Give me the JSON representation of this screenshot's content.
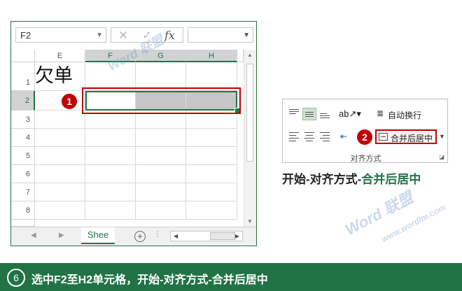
{
  "formula_bar": {
    "name_box": "F2",
    "fx": "fx"
  },
  "columns": [
    {
      "label": "E",
      "selected": false
    },
    {
      "label": "F",
      "selected": true
    },
    {
      "label": "G",
      "selected": true
    },
    {
      "label": "H",
      "selected": true
    }
  ],
  "rows": [
    "1",
    "2",
    "3",
    "4",
    "5",
    "6",
    "7",
    "8"
  ],
  "selected_row": "2",
  "cell_text": "欠单",
  "sheet_tab": "Shee",
  "badges": {
    "one": "1",
    "two": "2"
  },
  "ribbon": {
    "wrap_text": "自动换行",
    "merge_center": "合并后居中",
    "group_label": "对齐方式"
  },
  "caption": {
    "prefix": "开始-对齐方式-",
    "highlight": "合并后居中"
  },
  "bottom": {
    "step": "6",
    "text": "选中F2至H2单元格，开始-对齐方式-合并后居中"
  },
  "watermark": {
    "big": "Word 联盟",
    "small": "www.wordlm.com"
  },
  "colors": {
    "excel_green": "#217346",
    "highlight_red": "#c00000"
  }
}
